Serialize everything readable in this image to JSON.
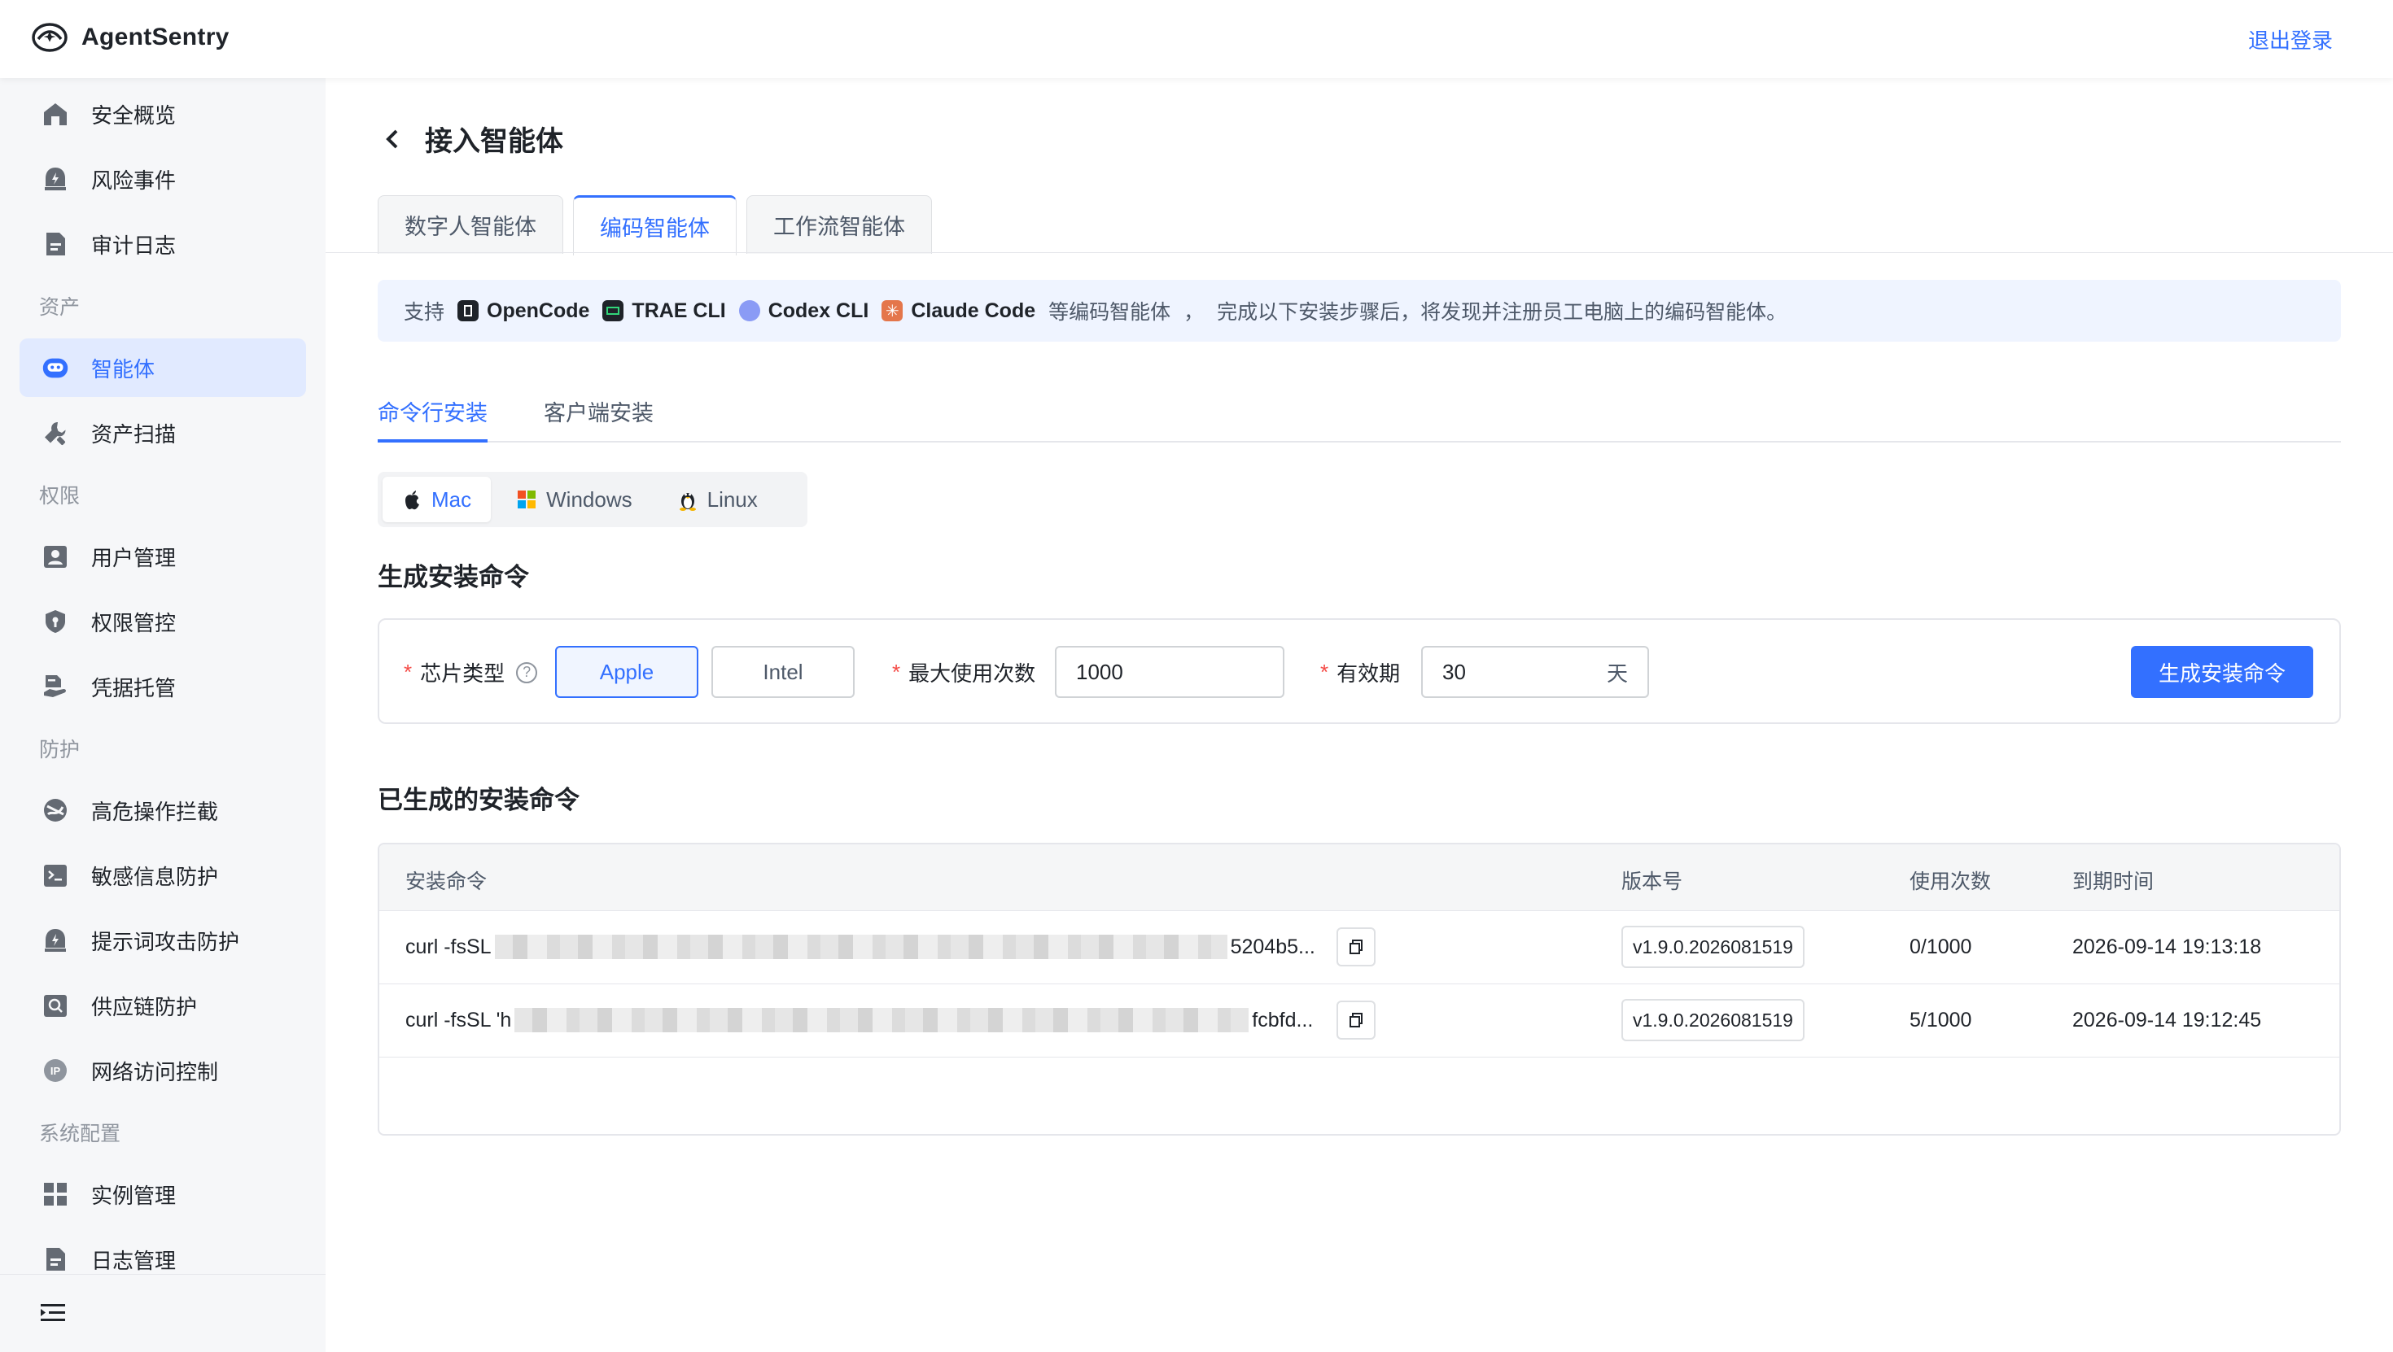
{
  "app": {
    "name": "AgentSentry",
    "logout": "退出登录"
  },
  "sidebar": {
    "items_top": [
      {
        "label": "安全概览",
        "icon": "home-icon"
      },
      {
        "label": "风险事件",
        "icon": "alert-icon"
      },
      {
        "label": "审计日志",
        "icon": "document-icon"
      }
    ],
    "group_assets": "资产",
    "items_assets": [
      {
        "label": "智能体",
        "icon": "robot-icon",
        "active": true
      },
      {
        "label": "资产扫描",
        "icon": "wrench-icon"
      }
    ],
    "group_perm": "权限",
    "items_perm": [
      {
        "label": "用户管理",
        "icon": "user-card-icon"
      },
      {
        "label": "权限管控",
        "icon": "shield-icon"
      },
      {
        "label": "凭据托管",
        "icon": "credential-icon"
      }
    ],
    "group_protect": "防护",
    "items_protect": [
      {
        "label": "高危操作拦截",
        "icon": "block-icon"
      },
      {
        "label": "敏感信息防护",
        "icon": "terminal-icon"
      },
      {
        "label": "提示词攻击防护",
        "icon": "bolt-icon"
      },
      {
        "label": "供应链防护",
        "icon": "search-box-icon"
      },
      {
        "label": "网络访问控制",
        "icon": "ip-icon"
      }
    ],
    "group_sys": "系统配置",
    "items_sys": [
      {
        "label": "实例管理",
        "icon": "grid-icon"
      },
      {
        "label": "日志管理",
        "icon": "document-icon"
      }
    ]
  },
  "page": {
    "title": "接入智能体"
  },
  "tabs": [
    "数字人智能体",
    "编码智能体",
    "工作流智能体"
  ],
  "active_tab": 1,
  "banner": {
    "prefix": "支持",
    "brands": [
      "OpenCode",
      "TRAE CLI",
      "Codex CLI",
      "Claude Code"
    ],
    "suffix_1": "等编码智能体",
    "sep": "，",
    "suffix_2": "完成以下安装步骤后，将发现并注册员工电脑上的编码智能体。"
  },
  "sub_tabs": [
    "命令行安装",
    "客户端安装"
  ],
  "os": [
    "Mac",
    "Windows",
    "Linux"
  ],
  "generate": {
    "title": "生成安装命令",
    "chip_label": "芯片类型",
    "chips": [
      "Apple",
      "Intel"
    ],
    "max_label": "最大使用次数",
    "max_value": "1000",
    "valid_label": "有效期",
    "valid_value": "30",
    "valid_unit": "天",
    "button": "生成安装命令"
  },
  "generated": {
    "title": "已生成的安装命令",
    "headers": [
      "安装命令",
      "版本号",
      "使用次数",
      "到期时间"
    ],
    "rows": [
      {
        "cmd_start": "curl -fsSL ",
        "cmd_end": "5204b5...",
        "version": "v1.9.0.2026081519",
        "uses": "0/1000",
        "expires": "2026-09-14 19:13:18"
      },
      {
        "cmd_start": "curl -fsSL 'h",
        "cmd_end": "fcbfd...",
        "version": "v1.9.0.2026081519",
        "uses": "5/1000",
        "expires": "2026-09-14 19:12:45"
      }
    ]
  },
  "colors": {
    "accent": "#3370ff",
    "required": "#f54a45",
    "active_bg": "#e1eaff"
  }
}
